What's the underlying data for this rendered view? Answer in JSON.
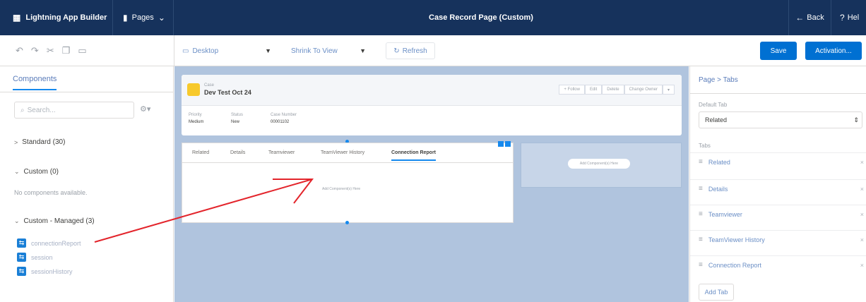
{
  "header": {
    "app_title": "Lightning App Builder",
    "pages_label": "Pages",
    "page_title": "Case Record Page (Custom)",
    "back_label": "Back",
    "help_label": "Hel"
  },
  "toolbar": {
    "device": "Desktop",
    "view": "Shrink To View",
    "refresh_label": "Refresh",
    "save_label": "Save",
    "activation_label": "Activation..."
  },
  "components": {
    "tab_label": "Components",
    "search_placeholder": "Search...",
    "standard": "Standard (30)",
    "custom": "Custom (0)",
    "no_components": "No components available.",
    "custom_managed": "Custom - Managed (3)",
    "items": [
      "connectionReport",
      "session",
      "sessionHistory"
    ]
  },
  "record": {
    "object_label": "Case",
    "name": "Dev Test Oct 24",
    "buttons": [
      "+ Follow",
      "Edit",
      "Delete",
      "Change Owner"
    ],
    "fields": [
      {
        "label": "Priority",
        "value": "Medium"
      },
      {
        "label": "Status",
        "value": "New"
      },
      {
        "label": "Case Number",
        "value": "00001102"
      }
    ],
    "tabs": [
      "Related",
      "Details",
      "Teamviewer",
      "TeamViewer History",
      "Connection Report"
    ],
    "active_tab": "Connection Report",
    "add_component_text": "Add Component(s) Here",
    "right_slot_text": "Add Component(s) Here"
  },
  "properties": {
    "breadcrumb": "Page > Tabs",
    "default_tab_label": "Default Tab",
    "default_tab_value": "Related",
    "tabs_label": "Tabs",
    "tabs": [
      "Related",
      "Details",
      "Teamviewer",
      "TeamViewer History",
      "Connection Report"
    ],
    "add_tab_label": "Add Tab"
  },
  "colors": {
    "header_bg": "#16325c",
    "brand_blue": "#0070d2",
    "canvas_bg": "#b0c4de",
    "annotation_arrow": "#e3242b"
  }
}
